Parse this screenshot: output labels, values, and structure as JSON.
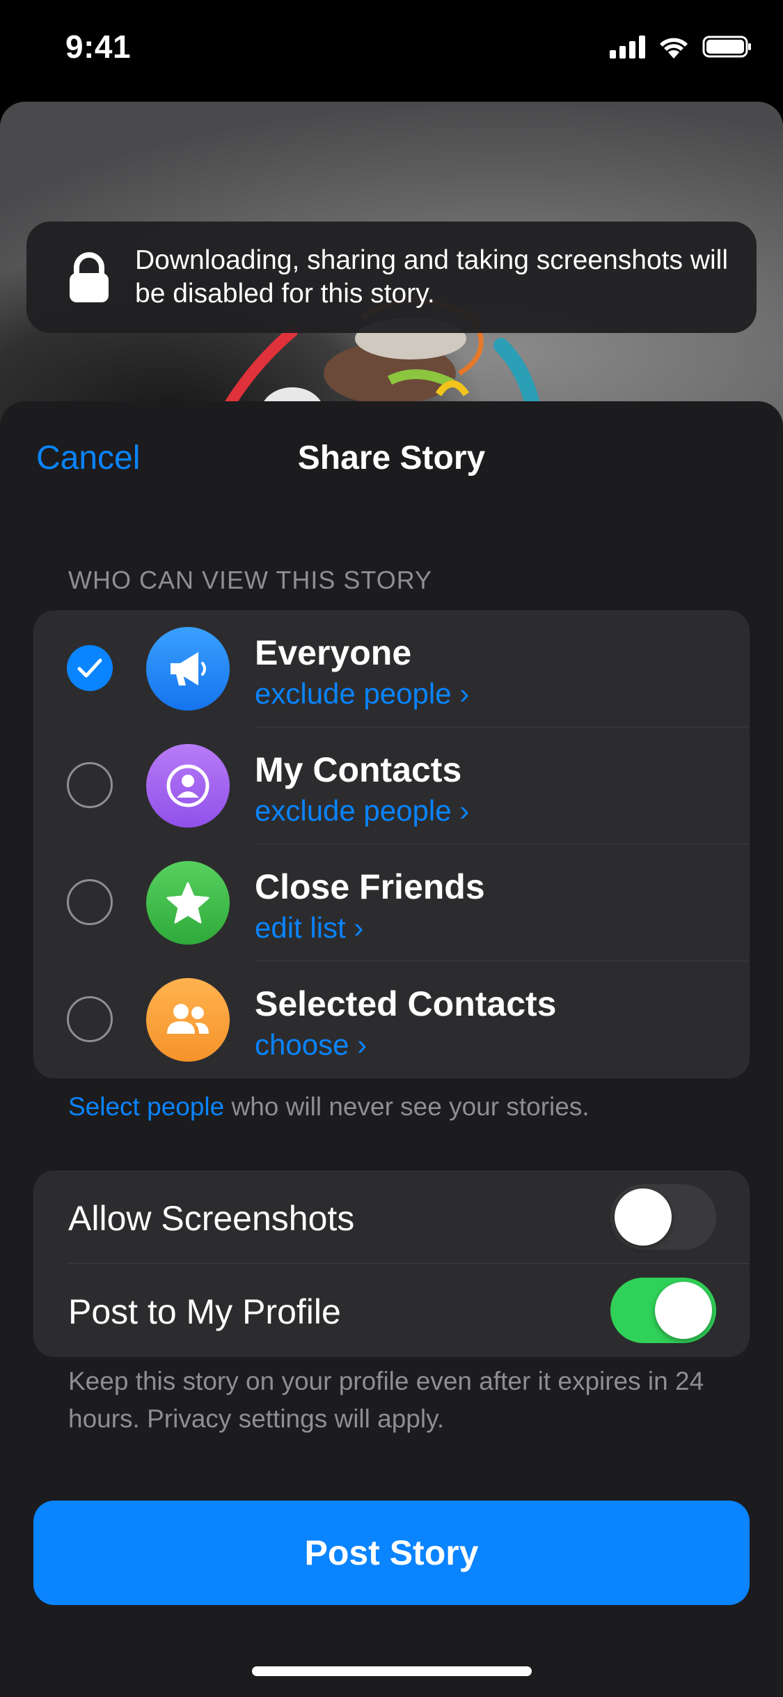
{
  "status_bar": {
    "time": "9:41"
  },
  "notice": {
    "text": "Downloading, sharing and taking screenshots will be disabled for this story.",
    "icon": "lock-icon"
  },
  "sheet": {
    "cancel_label": "Cancel",
    "title": "Share Story"
  },
  "audience": {
    "header": "WHO CAN VIEW THIS STORY",
    "options": [
      {
        "title": "Everyone",
        "subtitle": "exclude people ›",
        "icon": "megaphone-icon",
        "color": "#1e88ff",
        "selected": true
      },
      {
        "title": "My Contacts",
        "subtitle": "exclude people ›",
        "icon": "person-icon",
        "color": "#a35ef0",
        "selected": false
      },
      {
        "title": "Close Friends",
        "subtitle": "edit list ›",
        "icon": "star-icon",
        "color": "#3ec14a",
        "selected": false
      },
      {
        "title": "Selected Contacts",
        "subtitle": "choose ›",
        "icon": "group-icon",
        "color": "#f7a23e",
        "selected": false
      }
    ]
  },
  "select_note": {
    "link": "Select people",
    "text": " who will never see your stories."
  },
  "settings": {
    "allow_screenshots": {
      "label": "Allow Screenshots",
      "on": false
    },
    "post_to_profile": {
      "label": "Post to My Profile",
      "on": true
    }
  },
  "footer_note": "Keep this story on your profile even after it expires in 24 hours. Privacy settings will apply.",
  "post_button": "Post Story",
  "colors": {
    "accent": "#0a84ff",
    "toggle_on": "#30d158",
    "sheet_bg": "#1c1c1e",
    "cell_bg": "#2c2c2e"
  }
}
